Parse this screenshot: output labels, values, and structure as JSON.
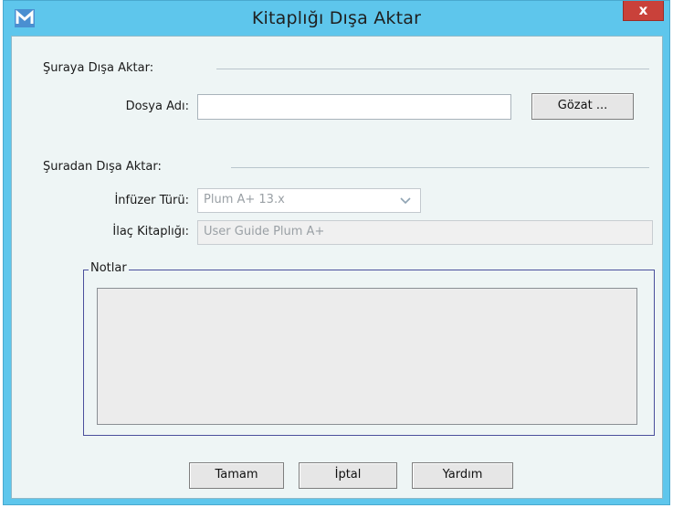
{
  "window": {
    "title": "Kitaplığı Dışa Aktar",
    "close_label": "x"
  },
  "export_to": {
    "section_label": "Şuraya Dışa Aktar:",
    "file_name_label": "Dosya Adı:",
    "file_name_value": "",
    "browse_label": "Gözat ..."
  },
  "export_from": {
    "section_label": "Şuradan Dışa Aktar:",
    "infuser_label": "İnfüzer Türü:",
    "infuser_value": "Plum A+ 13.x",
    "library_label": "İlaç Kitaplığı:",
    "library_value": "User Guide Plum A+"
  },
  "notes": {
    "legend": "Notlar",
    "value": ""
  },
  "buttons": {
    "ok": "Tamam",
    "cancel": "İptal",
    "help": "Yardım"
  }
}
